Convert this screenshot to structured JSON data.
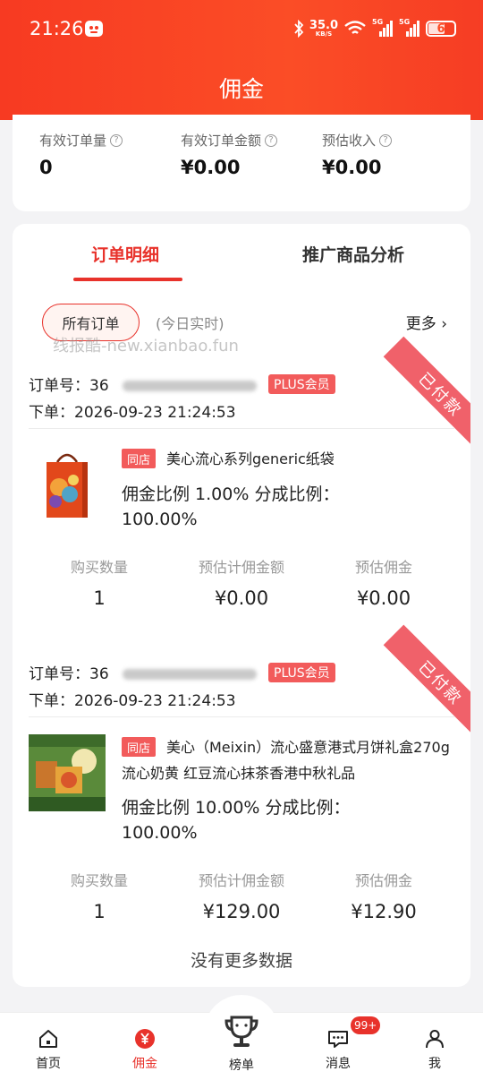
{
  "status_bar": {
    "time": "21:26",
    "speed_value": "35.0",
    "speed_unit": "KB/S",
    "net1": "5G",
    "net2": "5G",
    "battery": "6"
  },
  "page": {
    "title": "佣金"
  },
  "summary": [
    {
      "label": "有效订单量",
      "value": "0"
    },
    {
      "label": "有效订单金额",
      "value": "¥0.00"
    },
    {
      "label": "预估收入",
      "value": "¥0.00"
    }
  ],
  "tabs": [
    {
      "label": "订单明细",
      "active": true
    },
    {
      "label": "推广商品分析",
      "active": false
    }
  ],
  "filter": {
    "chip": "所有订单",
    "realtime": "(今日实时)",
    "more": "更多 ›"
  },
  "watermark": "线报酷-new.xianbao.fun",
  "orders": [
    {
      "order_no_label": "订单号：",
      "order_no_visible": "36",
      "badge": "PLUS会员",
      "time_label": "下单：",
      "time": "2026-09-23 21:24:53",
      "status": "已付款",
      "shop_tag": "同店",
      "product": "美心流心系列generic纸袋",
      "rate_line1": "佣金比例 1.00%    分成比例：",
      "rate_line2": "100.00%",
      "stats": [
        {
          "label": "购买数量",
          "value": "1"
        },
        {
          "label": "预估计佣金额",
          "value": "¥0.00"
        },
        {
          "label": "预估佣金",
          "value": "¥0.00"
        }
      ]
    },
    {
      "order_no_label": "订单号：",
      "order_no_visible": "36",
      "badge": "PLUS会员",
      "time_label": "下单：",
      "time": "2026-09-23 21:24:53",
      "status": "已付款",
      "shop_tag": "同店",
      "product": "美心（Meixin）流心盛意港式月饼礼盒270g 流心奶黄 红豆流心抹茶香港中秋礼品",
      "rate_line1": "佣金比例 10.00%    分成比例：",
      "rate_line2": "100.00%",
      "stats": [
        {
          "label": "购买数量",
          "value": "1"
        },
        {
          "label": "预估计佣金额",
          "value": "¥129.00"
        },
        {
          "label": "预估佣金",
          "value": "¥12.90"
        }
      ]
    }
  ],
  "footer": {
    "no_more": "没有更多数据"
  },
  "nav": [
    {
      "label": "首页",
      "icon": "home-icon",
      "active": false
    },
    {
      "label": "佣金",
      "icon": "yen-icon",
      "active": true
    },
    {
      "label": "榜单",
      "icon": "trophy-icon",
      "active": false
    },
    {
      "label": "消息",
      "icon": "message-icon",
      "active": false,
      "badge": "99+"
    },
    {
      "label": "我",
      "icon": "user-icon",
      "active": false
    }
  ],
  "colors": {
    "brand": "#f73a22",
    "accent": "#e8322b",
    "ribbon": "#f0616a",
    "tag": "#f25b5b"
  }
}
